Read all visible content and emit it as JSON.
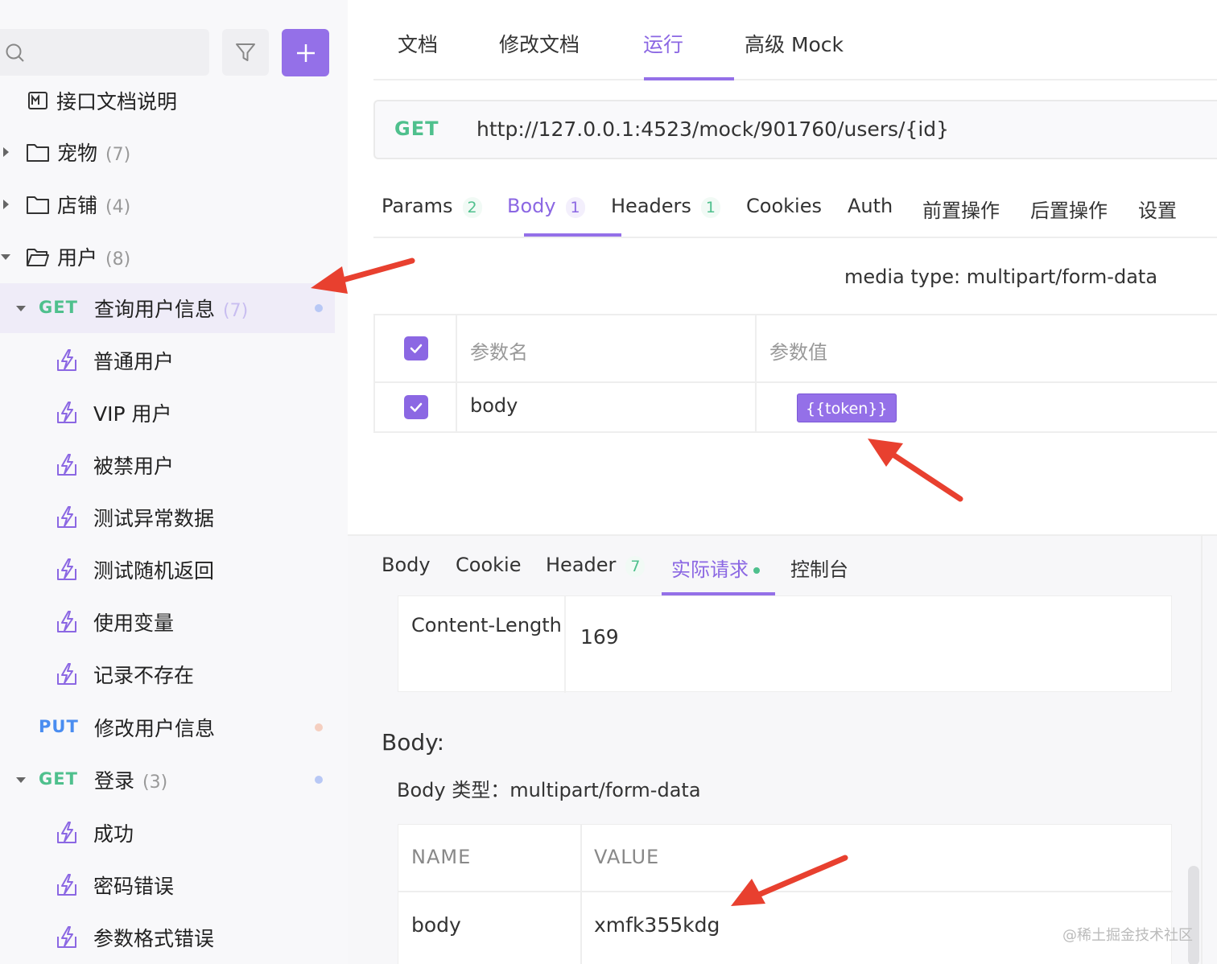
{
  "sidebar": {
    "search": {
      "placeholder": ""
    },
    "items": [
      {
        "type": "doc",
        "label": "接口文档说明"
      },
      {
        "type": "folder",
        "label": "宠物",
        "count": "(7)"
      },
      {
        "type": "folder",
        "label": "店铺",
        "count": "(4)"
      },
      {
        "type": "folder",
        "label": "用户",
        "count": "(8)"
      },
      {
        "type": "api",
        "method": "GET",
        "label": "查询用户信息",
        "count": "(7)"
      },
      {
        "type": "case",
        "label": "普通用户"
      },
      {
        "type": "case",
        "label": "VIP 用户"
      },
      {
        "type": "case",
        "label": "被禁用户"
      },
      {
        "type": "case",
        "label": "测试异常数据"
      },
      {
        "type": "case",
        "label": "测试随机返回"
      },
      {
        "type": "case",
        "label": "使用变量"
      },
      {
        "type": "case",
        "label": "记录不存在"
      },
      {
        "type": "api",
        "method": "PUT",
        "label": "修改用户信息"
      },
      {
        "type": "api",
        "method": "GET",
        "label": "登录",
        "count": "(3)"
      },
      {
        "type": "case",
        "label": "成功"
      },
      {
        "type": "case",
        "label": "密码错误"
      },
      {
        "type": "case",
        "label": "参数格式错误"
      }
    ]
  },
  "top_tabs": [
    "文档",
    "修改文档",
    "运行",
    "高级 Mock"
  ],
  "request": {
    "method": "GET",
    "url": "http://127.0.0.1:4523/mock/901760/users/{id}"
  },
  "sub_tabs": [
    {
      "label": "Params",
      "badge": "2"
    },
    {
      "label": "Body",
      "badge": "1"
    },
    {
      "label": "Headers",
      "badge": "1"
    },
    {
      "label": "Cookies"
    },
    {
      "label": "Auth"
    },
    {
      "label": "前置操作"
    },
    {
      "label": "后置操作"
    },
    {
      "label": "设置"
    }
  ],
  "body_params": {
    "media_type": "media type: multipart/form-data",
    "header_name": "参数名",
    "header_value": "参数值",
    "rows": [
      {
        "name": "body",
        "value": "{{token}}"
      }
    ]
  },
  "response_tabs": [
    {
      "label": "Body"
    },
    {
      "label": "Cookie"
    },
    {
      "label": "Header",
      "badge": "7"
    },
    {
      "label": "实际请求"
    },
    {
      "label": "控制台"
    }
  ],
  "actual_request": {
    "header_key": "Content-Length",
    "header_value": "169",
    "body_title": "Body:",
    "body_type": "Body 类型：multipart/form-data",
    "col_name": "NAME",
    "col_value": "VALUE",
    "rows": [
      {
        "name": "body",
        "value": "xmfk355kdg"
      }
    ]
  },
  "watermark": "@稀土掘金技术社区",
  "colors": {
    "accent": "#9470e8",
    "get": "#4fc08d",
    "put": "#4a8df0",
    "arrow": "#e8402f"
  }
}
